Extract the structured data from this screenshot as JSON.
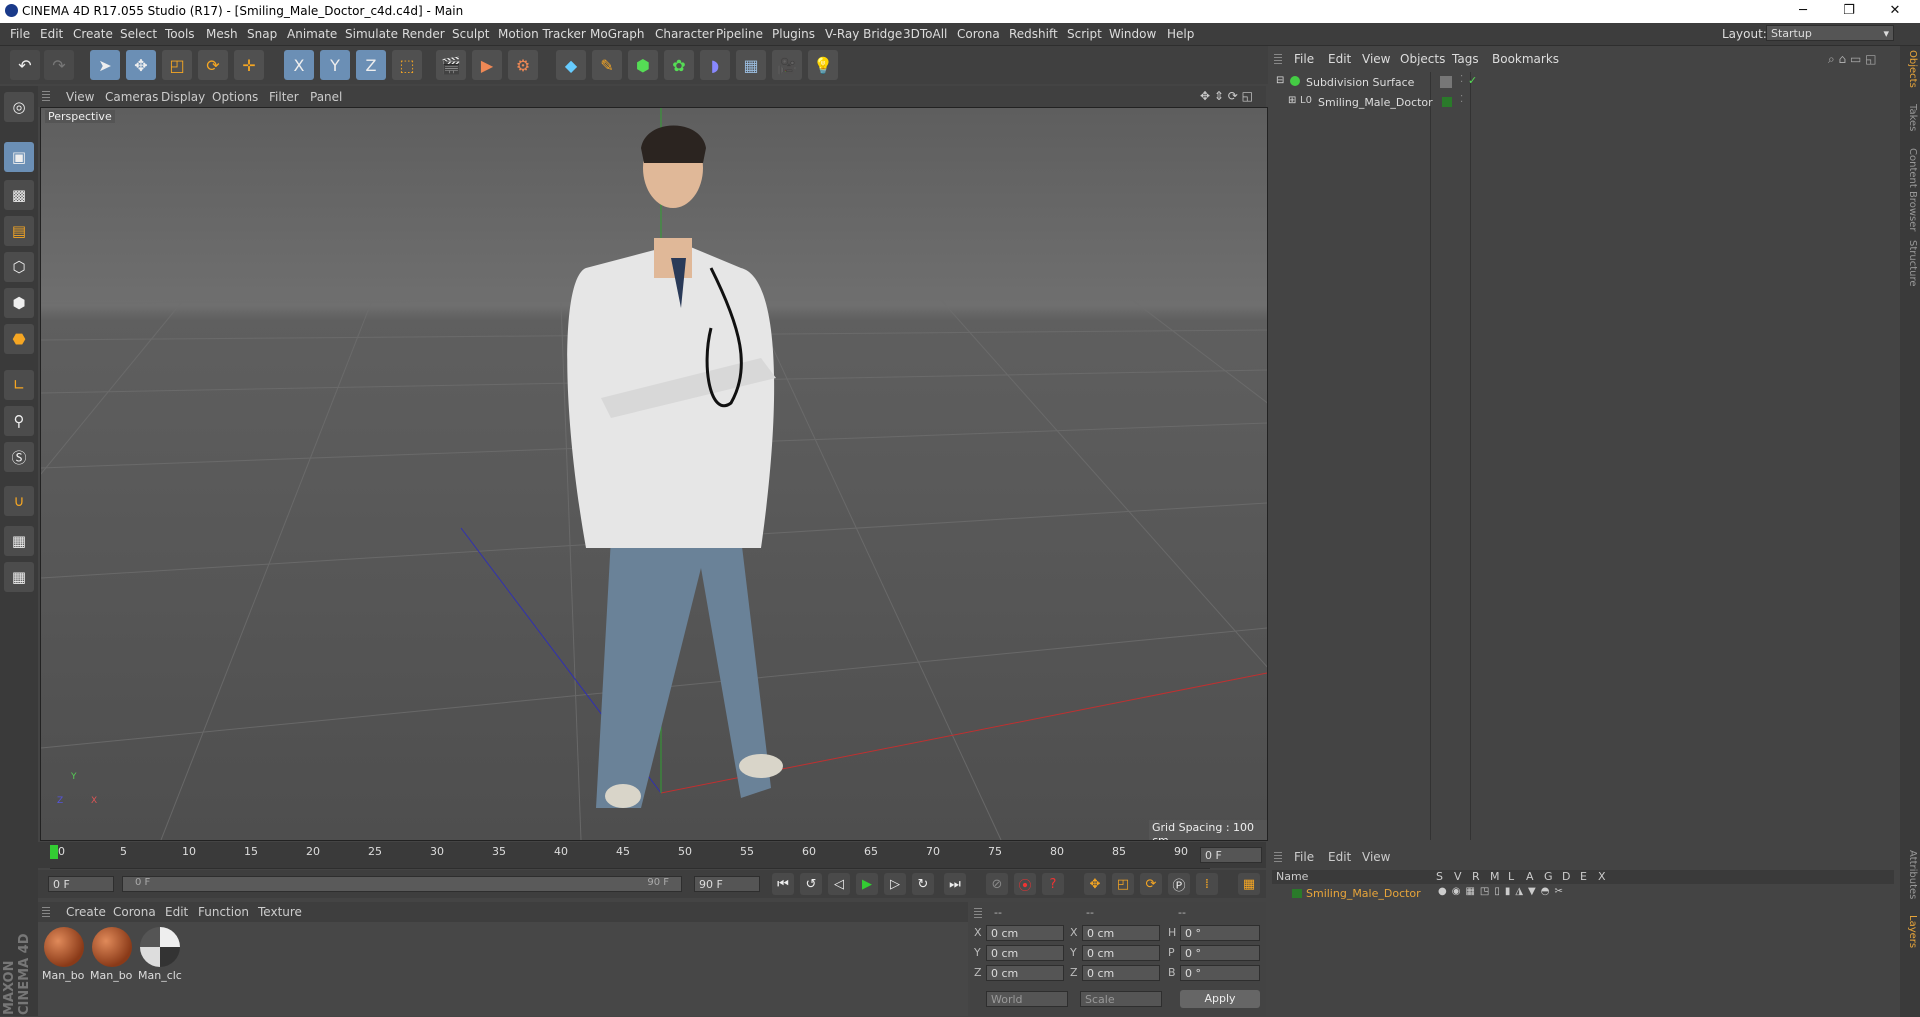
{
  "window": {
    "title": "CINEMA 4D R17.055 Studio (R17) - [Smiling_Male_Doctor_c4d.c4d] - Main",
    "minimize": "─",
    "maximize": "❐",
    "close": "✕"
  },
  "menubar": {
    "items": [
      "File",
      "Edit",
      "Create",
      "Select",
      "Tools",
      "Mesh",
      "Snap",
      "Animate",
      "Simulate",
      "Render",
      "Sculpt",
      "Motion Tracker",
      "MoGraph",
      "Character",
      "Pipeline",
      "Plugins",
      "V-Ray Bridge",
      "3DToAll",
      "Corona",
      "Redshift",
      "Script",
      "Window",
      "Help"
    ],
    "layout_label": "Layout:",
    "layout_value": "Startup"
  },
  "toolbar": {
    "icons": [
      "undo-icon",
      "redo-icon",
      "select-arrow-icon",
      "move-icon",
      "scale-icon",
      "rotate-icon",
      "transform-icon",
      "x-axis-icon",
      "y-axis-icon",
      "z-axis-icon",
      "coordinate-system-icon",
      "render-view-icon",
      "render-picture-viewer-icon",
      "render-settings-icon",
      "cube-primitive-icon",
      "pen-spline-icon",
      "subdivision-icon",
      "array-icon",
      "deformer-icon",
      "floor-icon",
      "camera-icon",
      "light-icon"
    ],
    "axis_x": "X",
    "axis_y": "Y",
    "axis_z": "Z"
  },
  "viewport": {
    "menu": [
      "View",
      "Cameras",
      "Display",
      "Options",
      "Filter",
      "Panel"
    ],
    "camera_label": "Perspective",
    "grid_spacing": "Grid Spacing : 100 cm",
    "axis_y": "Y",
    "axis_x": "X",
    "axis_z": "Z"
  },
  "timeline": {
    "ticks": [
      "0",
      "5",
      "10",
      "15",
      "20",
      "25",
      "30",
      "35",
      "40",
      "45",
      "50",
      "55",
      "60",
      "65",
      "70",
      "75",
      "80",
      "85",
      "90"
    ],
    "current_frame": "0 F"
  },
  "transport": {
    "start_field": "0 F",
    "range_start": "0 F",
    "range_end": "90 F",
    "end_field": "90 F"
  },
  "materials": {
    "menu": [
      "Create",
      "Corona",
      "Edit",
      "Function",
      "Texture"
    ],
    "items": [
      {
        "name": "Man_bo",
        "color": "#a0502a"
      },
      {
        "name": "Man_bo",
        "color": "#a0502a"
      },
      {
        "name": "Man_clc",
        "color": "#9a9a9a"
      }
    ]
  },
  "coordinates": {
    "headers": [
      "--",
      "--",
      "--"
    ],
    "rows": [
      {
        "a": "X",
        "av": "0 cm",
        "b": "X",
        "bv": "0 cm",
        "c": "H",
        "cv": "0 °"
      },
      {
        "a": "Y",
        "av": "0 cm",
        "b": "Y",
        "bv": "0 cm",
        "c": "P",
        "cv": "0 °"
      },
      {
        "a": "Z",
        "av": "0 cm",
        "b": "Z",
        "bv": "0 cm",
        "c": "B",
        "cv": "0 °"
      }
    ],
    "mode": "World",
    "scale_mode": "Scale",
    "apply": "Apply"
  },
  "objects": {
    "menu": [
      "File",
      "Edit",
      "View",
      "Objects",
      "Tags",
      "Bookmarks"
    ],
    "rows": [
      {
        "name": "Subdivision Surface",
        "color": "#ddd"
      },
      {
        "name": "Smiling_Male_Doctor",
        "color": "#ddd"
      }
    ]
  },
  "layers": {
    "menu": [
      "File",
      "Edit",
      "View"
    ],
    "header_name": "Name",
    "columns": [
      "S",
      "V",
      "R",
      "M",
      "L",
      "A",
      "G",
      "D",
      "E",
      "X"
    ],
    "row_name": "Smiling_Male_Doctor",
    "accent": "#e8a53a"
  },
  "right_tabs": [
    "Objects",
    "Takes",
    "Content Browser",
    "Structure"
  ],
  "right_tabs_lower": [
    "Attributes",
    "Layers"
  ],
  "brand": "MAXON CINEMA 4D"
}
